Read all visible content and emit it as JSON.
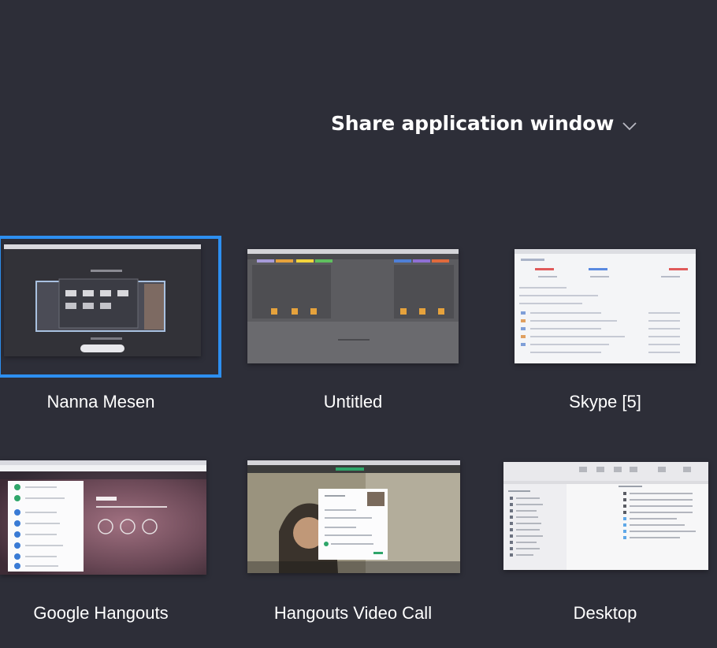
{
  "header": {
    "title": "Share application window"
  },
  "windows": [
    {
      "label": "Nanna Mesen",
      "selected": true
    },
    {
      "label": "Untitled",
      "selected": false
    },
    {
      "label": "Skype [5]",
      "selected": false
    },
    {
      "label": "Google Hangouts",
      "selected": false
    },
    {
      "label": "Hangouts Video Call",
      "selected": false
    },
    {
      "label": "Desktop",
      "selected": false
    }
  ],
  "colors": {
    "background": "#2d2e38",
    "selection": "#2d8ff0",
    "text": "#ffffff"
  }
}
